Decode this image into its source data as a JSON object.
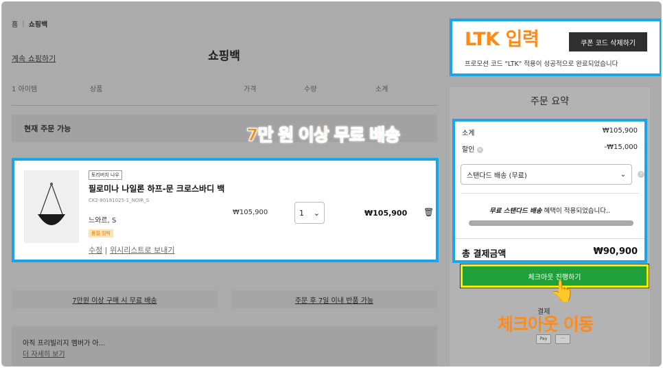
{
  "breadcrumb": [
    "홈",
    "쇼핑백"
  ],
  "header": {
    "continue_shopping": "계속 쇼핑하기",
    "title": "쇼핑백"
  },
  "table_header": {
    "item_count": "1 아이템",
    "product": "상품",
    "price": "가격",
    "quantity": "수량",
    "subtotal": "소계"
  },
  "section": {
    "available": "현재 주문 가능"
  },
  "product": {
    "brand_badge": "토리버치 나우",
    "name": "필로미나 나일론 하프-문 크로스바디 백",
    "code": "CK2-80181025-1_NOIR_S",
    "option": "느와르, S",
    "stock_badge": "품절 임박",
    "edit": "수정",
    "wishlist": "위시리스트로 보내기",
    "price": "₩105,900",
    "quantity": "1",
    "total": "₩105,900"
  },
  "annotations": {
    "promo": "7만 원 이상 무료 배송",
    "ltk": "LTK 입력",
    "checkout": "체크아웃 이동"
  },
  "benefits": [
    "7만원 이상 구매 시 무료 배송",
    "주문 후 7일 이내 반품 가능"
  ],
  "member": {
    "text": "아직 프리빌리지 멤버가 아...",
    "more": "더 자세히 보기"
  },
  "coupon": {
    "delete_button": "쿠폰 코드 삭제하기",
    "message": "프로모션 코드 \"LTK\" 적용이 성공적으로 완료되었습니다"
  },
  "summary": {
    "title": "주문 요약",
    "subtotal_label": "소계",
    "subtotal_value": "₩105,900",
    "discount_label": "할인",
    "discount_value": "-₩15,000",
    "shipping_option": "스탠다드 배송 (무료)",
    "free_shipping_bold": "무료 스탠다드 배송",
    "free_shipping_rest": " 혜택이 적용되었습니다..",
    "progress": 1.0,
    "total_label": "총 결제금액",
    "total_value": "₩90,900"
  },
  "checkout": {
    "button": "체크아웃 진행하기",
    "payment_label": "결제",
    "pay_methods": [
      "Pay",
      "···"
    ]
  },
  "colors": {
    "highlight_border": "#1aa5e8",
    "annotation": "#ff8a1a",
    "checkout_green": "#1fa039",
    "checkout_outline": "#f4f000"
  }
}
